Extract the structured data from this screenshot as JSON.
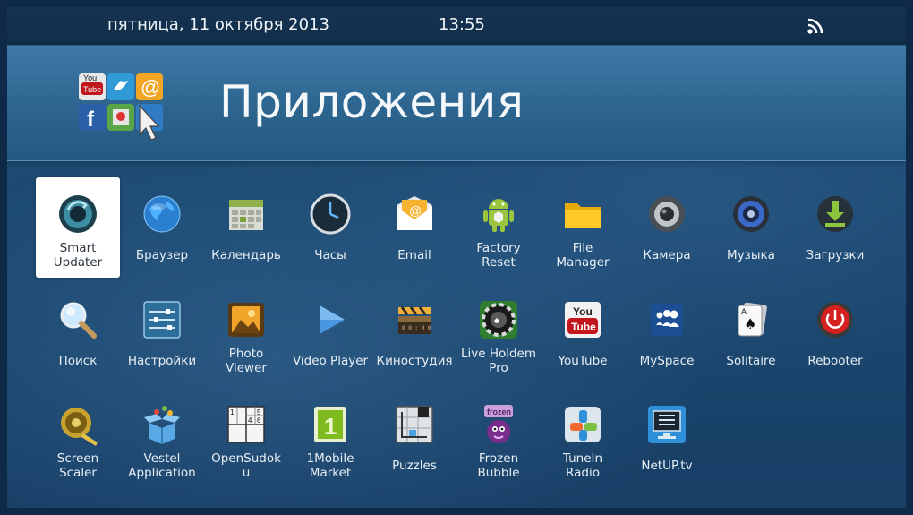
{
  "status": {
    "date": "пятница, 11 октября 2013",
    "time": "13:55"
  },
  "header": {
    "title": "Приложения"
  },
  "apps": [
    {
      "label": "Smart\nUpdater"
    },
    {
      "label": "Браузер"
    },
    {
      "label": "Календарь"
    },
    {
      "label": "Часы"
    },
    {
      "label": "Email"
    },
    {
      "label": "Factory\nReset"
    },
    {
      "label": "File\nManager"
    },
    {
      "label": "Камера"
    },
    {
      "label": "Музыка"
    },
    {
      "label": "Загрузки"
    },
    {
      "label": "Поиск"
    },
    {
      "label": "Настройки"
    },
    {
      "label": "Photo\nViewer"
    },
    {
      "label": "Video Player"
    },
    {
      "label": "Киностудия"
    },
    {
      "label": "Live Holdem\nPro"
    },
    {
      "label": "YouTube",
      "icon_text": "You"
    },
    {
      "label": "MySpace"
    },
    {
      "label": "Solitaire"
    },
    {
      "label": "Rebooter"
    },
    {
      "label": "Screen\nScaler"
    },
    {
      "label": "Vestel\nApplication"
    },
    {
      "label": "OpenSudok\nu",
      "grid": [
        "1",
        "5",
        "4",
        "6"
      ]
    },
    {
      "label": "1Mobile\nMarket",
      "icon_text": "1"
    },
    {
      "label": "Puzzles"
    },
    {
      "label": "Frozen\nBubble"
    },
    {
      "label": "TuneIn\nRadio"
    },
    {
      "label": "NetUP.tv"
    }
  ],
  "colors": {
    "statusbar": "#112d49",
    "header": "#2f6893",
    "background": "#1c4a72",
    "selected_tile": "#ffffff"
  }
}
